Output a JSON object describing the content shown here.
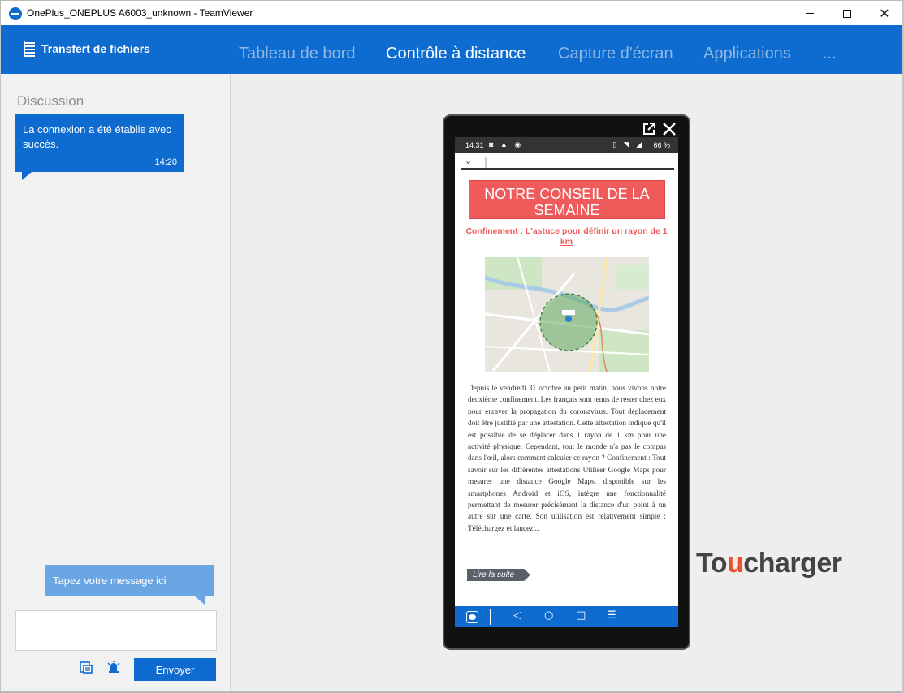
{
  "window": {
    "title": "OnePlus_ONEPLUS A6003_unknown - TeamViewer",
    "controls": [
      "minimize-icon",
      "maximize-icon",
      "close-icon"
    ]
  },
  "header": {
    "file_transfer_label": "Transfert de fichiers",
    "tabs": [
      {
        "label": "Tableau de bord",
        "active": false
      },
      {
        "label": "Contrôle à distance",
        "active": true
      },
      {
        "label": "Capture d'écran",
        "active": false
      },
      {
        "label": "Applications",
        "active": false
      },
      {
        "label": "...",
        "active": false
      }
    ]
  },
  "chat": {
    "title": "Discussion",
    "messages": [
      {
        "text": "La connexion a été établie avec succès.",
        "time": "14:20"
      }
    ],
    "input_hint": "Tapez votre message ici",
    "input_value": "",
    "send_label": "Envoyer",
    "tool_icons": [
      "file-box-icon",
      "alarm-icon"
    ]
  },
  "phone": {
    "status": {
      "time": "14:31",
      "left_icons": "◙ ▲ ◉",
      "right_icons": "▯ ◥ ◢",
      "battery": "66 %"
    },
    "page": {
      "banner": "NOTRE CONSEIL DE LA SEMAINE",
      "article_title": "Confinement : L'astuce pour définir un rayon de 1 km",
      "body": "Depuis le vendredi 31 octobre au petit matin, nous vivons notre deuxième confinement. Les français sont tenus de rester chez eux pour enrayer la propagation du coronavirus. Tout déplacement doit être justifié par une attestation. Cette attestation indique qu'il est possible de se déplacer dans 1 rayon de 1 km pour une activité physique. Cependant, tout le monde n'a pas le compas dans l'œil, alors comment calculer ce rayon ? Confinement : Tout savoir sur les différentes attestations Utiliser Google Maps pour mesurer une distance Google Maps, disponible sur les smartphones Android et iOS, intègre une fonctionnalité permettant de mesurer précisément la distance d'un point à un autre sur une carte. Son utilisation est relativement simple : Téléchargez et lancez...",
      "read_more": "Lire la suite"
    }
  },
  "watermark": {
    "prefix": "To",
    "accent": "u",
    "suffix": "charger"
  },
  "colors": {
    "brand_blue": "#0e6bcf",
    "banner_red": "#ef5a5a",
    "logo_orange": "#e9522b"
  }
}
